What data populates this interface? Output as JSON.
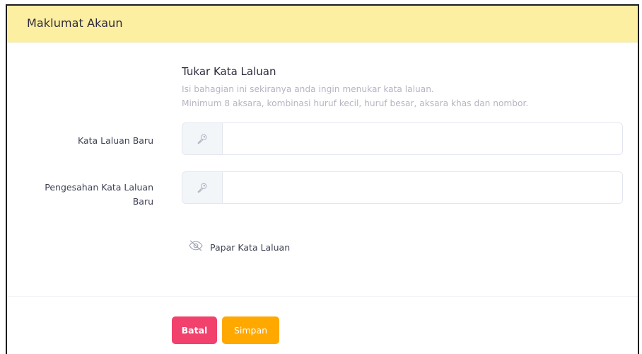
{
  "header": {
    "title": "Maklumat Akaun"
  },
  "section": {
    "title": "Tukar Kata Laluan",
    "hint_line1": "Isi bahagian ini sekiranya anda ingin menukar kata laluan.",
    "hint_line2": "Minimum 8 aksara, kombinasi huruf kecil, huruf besar, aksara khas dan nombor."
  },
  "fields": {
    "new_password": {
      "label": "Kata Laluan Baru",
      "value": "",
      "icon": "key-icon"
    },
    "confirm_password": {
      "label_line1": "Pengesahan Kata Laluan",
      "label_line2": "Baru",
      "value": "",
      "icon": "key-icon"
    }
  },
  "show_password": {
    "label": "Papar Kata Laluan",
    "icon": "eye-slash-icon"
  },
  "actions": {
    "cancel_label": "Batal",
    "save_label": "Simpan"
  },
  "colors": {
    "header_bg": "#fcefa2",
    "cancel_bg": "#f1416c",
    "save_bg": "#ffa800",
    "hint_text": "#b5b5c3"
  }
}
